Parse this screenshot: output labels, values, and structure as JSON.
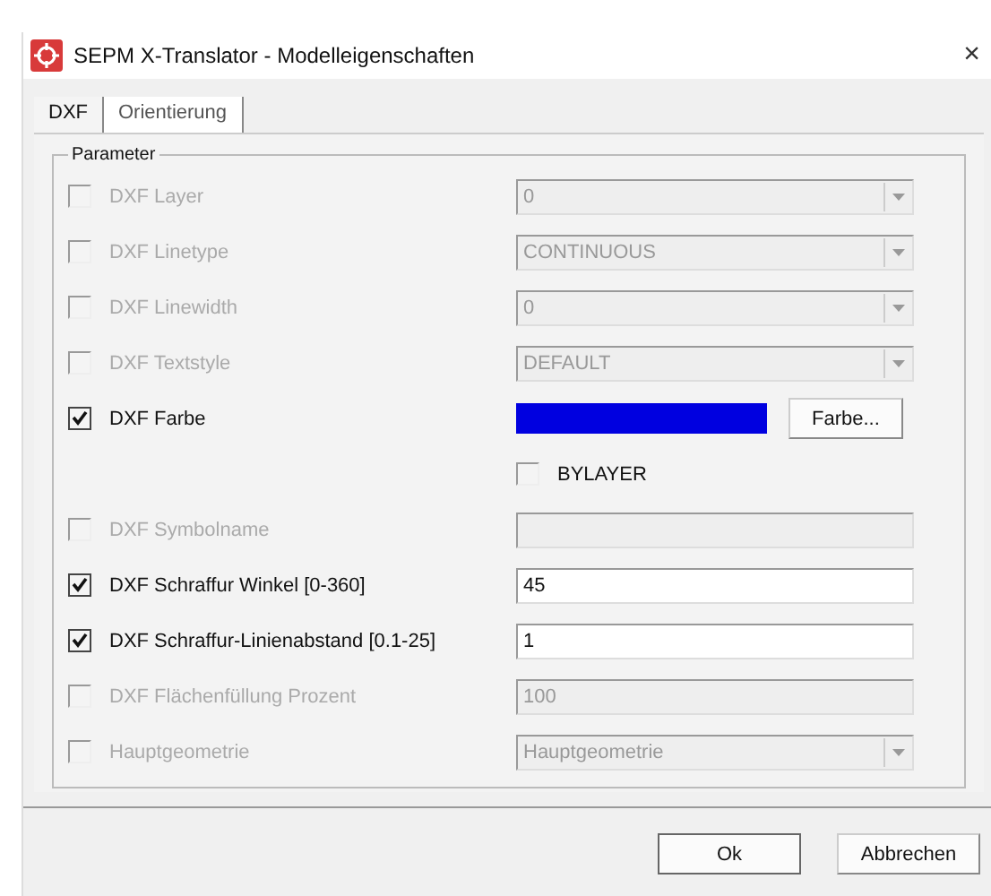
{
  "window": {
    "title": "SEPM X-Translator - Modelleigenschaften",
    "close": "×"
  },
  "tabs": [
    {
      "label": "DXF",
      "selected": true
    },
    {
      "label": "Orientierung",
      "selected": false
    }
  ],
  "group": {
    "title": "Parameter"
  },
  "rows": [
    {
      "kind": "dropdown",
      "label": "DXF Layer",
      "checked": false,
      "disabled": true,
      "value": "0"
    },
    {
      "kind": "dropdown",
      "label": "DXF Linetype",
      "checked": false,
      "disabled": true,
      "value": "CONTINUOUS"
    },
    {
      "kind": "dropdown",
      "label": "DXF Linewidth",
      "checked": false,
      "disabled": true,
      "value": "0"
    },
    {
      "kind": "dropdown",
      "label": "DXF Textstyle",
      "checked": false,
      "disabled": true,
      "value": "DEFAULT"
    },
    {
      "kind": "color",
      "label": "DXF Farbe",
      "checked": true,
      "disabled": false,
      "color": "#0000e0",
      "button": "Farbe..."
    },
    {
      "kind": "option",
      "label": "BYLAYER",
      "checked": false,
      "disabled": false
    },
    {
      "kind": "text",
      "label": "DXF Symbolname",
      "checked": false,
      "disabled": true
    },
    {
      "kind": "text",
      "label": "DXF Schraffur Winkel [0-360]",
      "checked": true,
      "disabled": false,
      "value": "45"
    },
    {
      "kind": "text",
      "label": "DXF Schraffur-Linienabstand [0.1-25]",
      "checked": true,
      "disabled": false,
      "value": "1"
    },
    {
      "kind": "text",
      "label": "DXF Flächenfüllung Prozent",
      "checked": false,
      "disabled": true,
      "value": "100"
    },
    {
      "kind": "dropdown",
      "label": "Hauptgeometrie",
      "checked": false,
      "disabled": true,
      "value": "Hauptgeometrie"
    }
  ],
  "buttons": [
    {
      "label": "Ok",
      "default": true
    },
    {
      "label": "Abbrechen",
      "default": false
    }
  ]
}
